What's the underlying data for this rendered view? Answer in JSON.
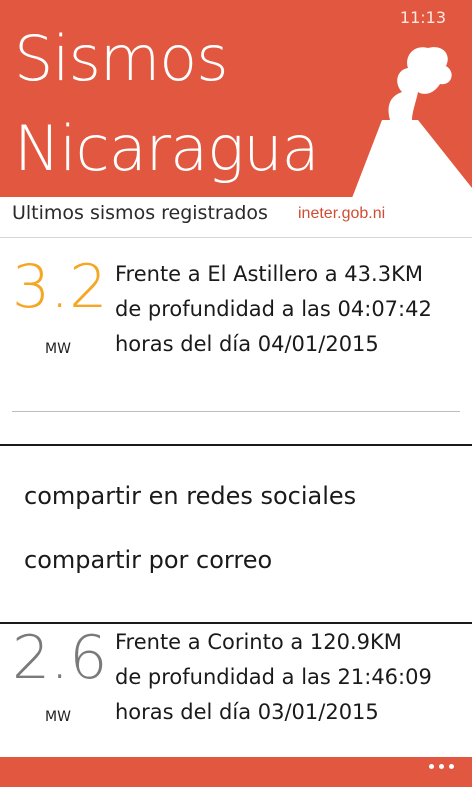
{
  "status": {
    "time": "11:13"
  },
  "header": {
    "title_line1": "Sismos",
    "title_line2": "Nicaragua"
  },
  "subheader": {
    "label": "Ultimos sismos registrados",
    "source": "ineter.gob.ni"
  },
  "quakes": [
    {
      "magnitude": "3.2",
      "unit": "MW",
      "line1": "Frente a El Astillero a 43.3KM",
      "line2": "de profundidad a las 04:07:42",
      "line3": "horas del día 04/01/2015",
      "color": "#f5a623"
    },
    {
      "magnitude": "2.6",
      "unit": "MW",
      "line1": "Frente a Corinto a 120.9KM",
      "line2": "de profundidad a las 21:46:09",
      "line3": "horas del día 03/01/2015",
      "color": "#7a7a7a"
    }
  ],
  "context_menu": {
    "share_social": "compartir en redes sociales",
    "share_email": "compartir por correo"
  },
  "app_bar": {
    "more_icon": "ellipsis-icon"
  },
  "colors": {
    "accent": "#e1573f"
  }
}
